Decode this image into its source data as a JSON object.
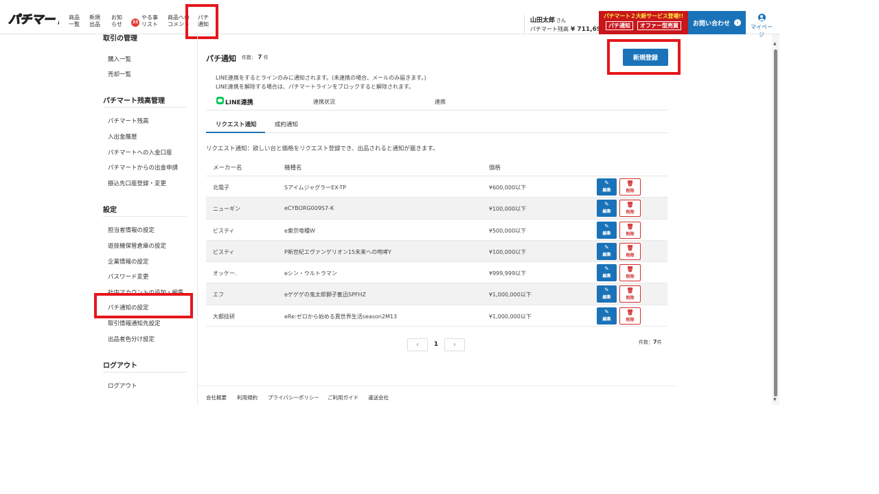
{
  "header": {
    "logo_text": "パチマート",
    "nav": [
      {
        "line1": "商品",
        "line2": "一覧"
      },
      {
        "line1": "新規",
        "line2": "出品"
      },
      {
        "line1": "お知",
        "line2": "らせ"
      },
      {
        "line1": "やる事",
        "line2": "リスト",
        "badge": "33"
      },
      {
        "line1": "商品への",
        "line2": "コメント"
      },
      {
        "line1": "パチ",
        "line2": "通知"
      }
    ],
    "user_name": "山田太郎",
    "user_suffix": "さん",
    "balance_label": "パチマート残高",
    "balance_value": "¥ 711,694",
    "promo_title": "パチマート２大新サービス登場!!",
    "promo_tag1": "パチ通知",
    "promo_tag2": "オファー型売買",
    "contact_label": "お問い合わせ",
    "mypage_label": "マイページ"
  },
  "sidebar": {
    "sections": [
      {
        "title": "取引の管理",
        "items": [
          "購入一覧",
          "売却一覧"
        ]
      },
      {
        "title": "パチマート残高管理",
        "items": [
          "パチマート残高",
          "入出金履歴",
          "パチマートへの入金口座",
          "パチマートからの出金申請",
          "振込先口座登録・変更"
        ]
      },
      {
        "title": "設定",
        "items": [
          "担当者情報の設定",
          "遊技機保管倉庫の設定",
          "企業情報の設定",
          "パスワード変更",
          "社内アカウントの追加・編集",
          "パチ通知の設定",
          "取引情報通知先設定",
          "出品者色分け設定"
        ]
      },
      {
        "title": "ログアウト",
        "items": [
          "ログアウト"
        ]
      }
    ]
  },
  "main": {
    "title": "パチ通知",
    "count_label": "件数：",
    "count_value": "7",
    "count_unit": "件",
    "new_button": "新規登録",
    "desc1": "LINE連携をするとラインのみに通知されます。(未連携の場合、メールのみ届きます。)",
    "desc2": "LINE連携を解除する場合は、パチマートラインをブロックすると解除されます。",
    "line_label": "LINE連携",
    "line_status_label": "連携状況",
    "line_status": "連携",
    "tabs": [
      "リクエスト通知",
      "成約通知"
    ],
    "request_desc": "リクエスト通知：欲しい台と価格をリクエスト登録でき、出品されると通知が届きます。",
    "columns": [
      "メーカー名",
      "機種名",
      "価格"
    ],
    "rows": [
      {
        "maker": "北電子",
        "model": "SアイムジャグラーEX-TP",
        "price": "¥600,000以下"
      },
      {
        "maker": "ニューギン",
        "model": "eCYBORG009S7-K",
        "price": "¥100,000以下"
      },
      {
        "maker": "ビスティ",
        "model": "e東京喰種W",
        "price": "¥500,000以下"
      },
      {
        "maker": "ビスティ",
        "model": "P新世紀エヴァンゲリオン15未来への咆哮Y",
        "price": "¥100,000以下"
      },
      {
        "maker": "オッケー.",
        "model": "eシン・ウルトラマン",
        "price": "¥999,999以下"
      },
      {
        "maker": "エフ",
        "model": "eゲゲゲの鬼太郎獅子奮迅SPFHZ",
        "price": "¥1,000,000以下"
      },
      {
        "maker": "大都技研",
        "model": "eRe:ゼロから始める異世界生活season2M13",
        "price": "¥1,000,000以下"
      }
    ],
    "edit_label": "編集",
    "delete_label": "削除",
    "page_current": "1",
    "page_prev": "‹",
    "page_next": "›"
  },
  "footer": {
    "links": [
      "会社概要",
      "利用規約",
      "プライバシーポリシー",
      "ご利用ガイド",
      "運送会社"
    ]
  },
  "colors": {
    "primary": "#1a73b8",
    "danger": "#d32f2f",
    "highlight": "#e4161b",
    "line_green": "#06c755"
  }
}
